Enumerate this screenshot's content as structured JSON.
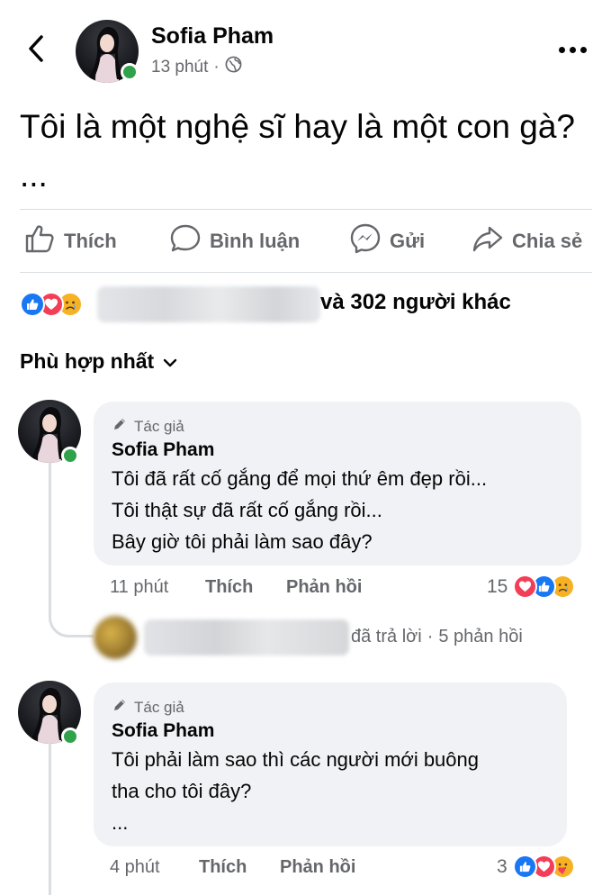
{
  "header": {
    "back_icon": "chevron-left-icon",
    "poster_name": "Sofia Pham",
    "time": "13 phút",
    "separator": "·",
    "privacy_icon": "globe-icon",
    "more_icon": "more-horizontal-icon"
  },
  "post": {
    "text": "Tôi là một nghệ sĩ hay là một con gà? ..."
  },
  "actions": [
    {
      "label": "Thích",
      "icon": "like-thumb-icon"
    },
    {
      "label": "Bình luận",
      "icon": "comment-bubble-icon"
    },
    {
      "label": "Gửi",
      "icon": "messenger-icon"
    },
    {
      "label": "Chia sẻ",
      "icon": "share-arrow-icon"
    }
  ],
  "reactions_summary": {
    "icons": [
      "like-reaction-icon",
      "love-reaction-icon",
      "sad-reaction-icon"
    ],
    "others_text": "và 302 người khác"
  },
  "sort": {
    "label": "Phù hợp nhất",
    "icon": "chevron-down-icon"
  },
  "comments": [
    {
      "badge": "Tác giả",
      "badge_icon": "pencil-icon",
      "name": "Sofia Pham",
      "lines": [
        "Tôi đã rất cố gắng để mọi thứ êm đẹp rồi...",
        "Tôi thật sự đã rất cố gắng rồi...",
        "Bây giờ tôi phải làm sao đây?"
      ],
      "time": "11 phút",
      "like_label": "Thích",
      "reply_label": "Phản hồi",
      "reaction_count": "15",
      "reaction_icons": [
        "love-reaction-icon",
        "like-reaction-icon",
        "sad-reaction-icon"
      ],
      "replies": {
        "text": "đã trả lời",
        "separator": "·",
        "count_text": "5 phản hồi"
      }
    },
    {
      "badge": "Tác giả",
      "badge_icon": "pencil-icon",
      "name": "Sofia Pham",
      "lines": [
        "Tôi phải làm sao thì các người mới buông",
        "tha cho tôi đây?",
        "..."
      ],
      "time": "4 phút",
      "like_label": "Thích",
      "reply_label": "Phản hồi",
      "reaction_count": "3",
      "reaction_icons": [
        "like-reaction-icon",
        "love-reaction-icon",
        "care-reaction-icon"
      ]
    }
  ],
  "colors": {
    "text": "#050505",
    "secondary": "#65676b",
    "bubble": "#f0f2f5",
    "online": "#31a24c",
    "like_blue": "#1877f2",
    "love_red": "#f33e58",
    "sad_yellow": "#f7b125"
  }
}
